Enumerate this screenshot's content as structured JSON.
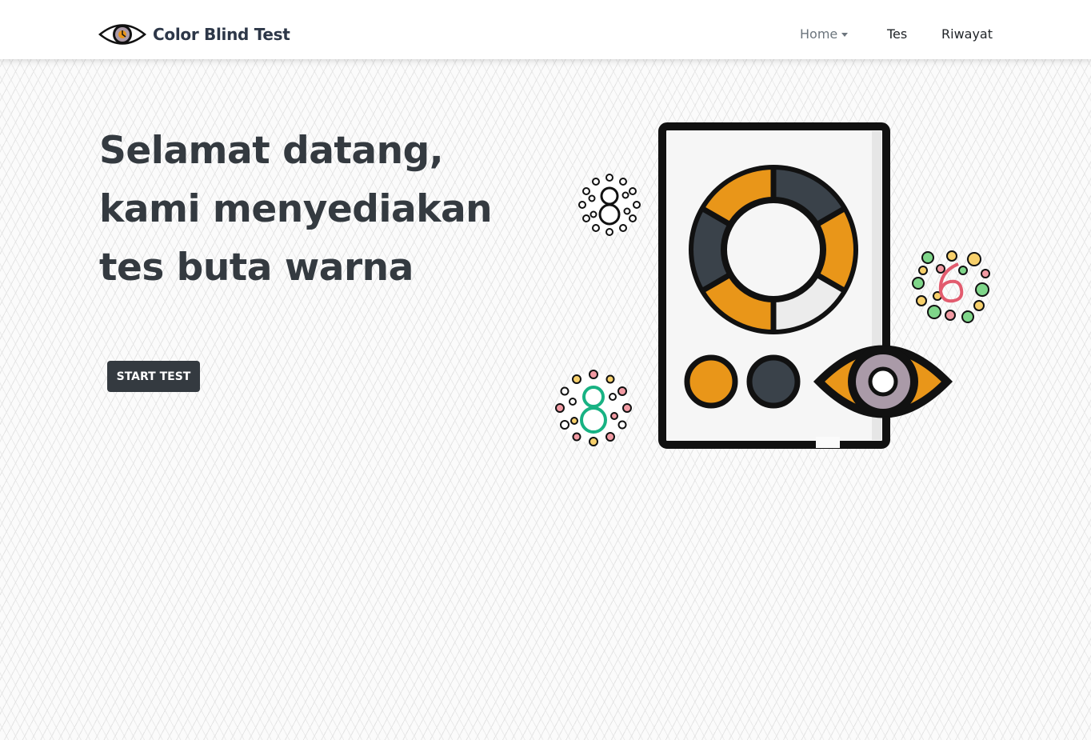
{
  "brand": {
    "name": "Color Blind Test",
    "icon": "eye-logo-icon"
  },
  "nav": {
    "home": "Home",
    "tes": "Tes",
    "riwayat": "Riwayat"
  },
  "hero": {
    "title": "Selamat datang, kami menyediakan tes buta warna",
    "button": "START TEST"
  },
  "illustration": {
    "icon": "color-blind-test-card-illustration",
    "plates": [
      "8",
      "6",
      "8"
    ]
  },
  "colors": {
    "primary_dark": "#343a40",
    "accent_orange": "#e99619",
    "dark_slate": "#3a424a",
    "navbar_bg": "#ffffff"
  }
}
